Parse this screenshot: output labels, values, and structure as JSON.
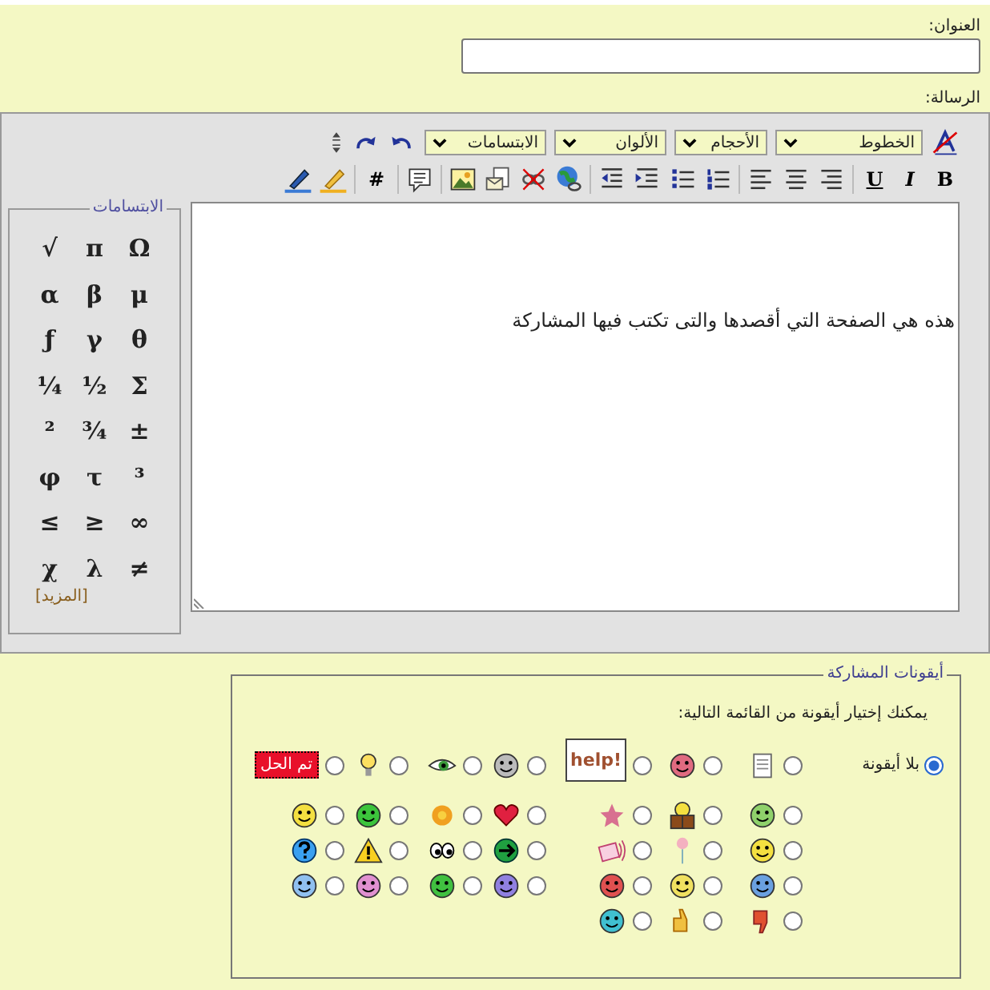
{
  "subject": {
    "label": "العنوان:"
  },
  "message": {
    "label": "الرسالة:",
    "text": "هذه هي الصفحة التي أقصدها والتى تكتب فيها المشاركة"
  },
  "toolbar": {
    "selects": [
      "الخطوط",
      "الأحجام",
      "الألوان",
      "الابتسامات"
    ],
    "format_buttons": [
      "B",
      "I",
      "U"
    ],
    "hash_button": "#"
  },
  "symbols": {
    "legend": "الابتسامات",
    "items": [
      "Ω",
      "π",
      "√",
      "μ",
      "β",
      "α",
      "θ",
      "γ",
      "ƒ",
      "Σ",
      "½",
      "¼",
      "±",
      "¾",
      "²",
      "³",
      "τ",
      "φ",
      "∞",
      "≥",
      "≤",
      "≠",
      "λ",
      "χ"
    ],
    "more_link": "[المزيد]"
  },
  "post_icons": {
    "legend": "أيقونات المشاركة",
    "hint": "يمكنك إختيار أيقونة من القائمة التالية:",
    "none_option": {
      "label": "بلا أيقونة",
      "selected": true
    },
    "rows": [
      [
        {
          "selected": false
        },
        {
          "selected": false
        },
        {
          "selected": false,
          "label": "help!"
        },
        {
          "selected": false
        },
        {
          "selected": false
        },
        {
          "selected": false
        },
        {
          "selected": false,
          "label": "تم الحل"
        }
      ],
      [
        {
          "selected": false
        },
        {
          "selected": false
        },
        {
          "selected": false
        },
        {
          "selected": false
        },
        {
          "selected": false
        },
        {
          "selected": false
        },
        {
          "selected": false
        }
      ],
      [
        {
          "selected": false
        },
        {
          "selected": false
        },
        {
          "selected": false
        },
        {
          "selected": false
        },
        {
          "selected": false
        },
        {
          "selected": false
        },
        {
          "selected": false
        }
      ],
      [
        {
          "selected": false
        },
        {
          "selected": false
        },
        {
          "selected": false
        },
        {
          "selected": false
        },
        {
          "selected": false
        },
        {
          "selected": false
        },
        {
          "selected": false
        }
      ],
      [
        {
          "selected": false
        },
        {
          "selected": false
        },
        {
          "selected": false
        }
      ]
    ]
  }
}
